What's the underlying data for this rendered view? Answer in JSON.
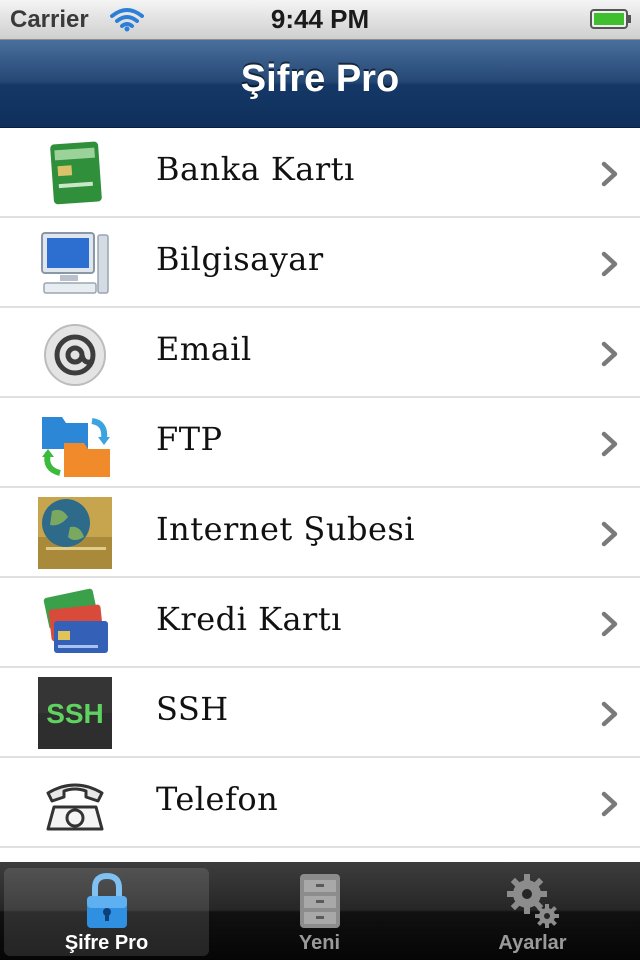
{
  "status_bar": {
    "carrier": "Carrier",
    "time": "9:44 PM",
    "wifi_icon": "wifi-icon",
    "battery_icon": "battery-icon"
  },
  "nav": {
    "title": "Şifre Pro"
  },
  "list": {
    "items": [
      {
        "label": "Banka Kartı",
        "icon": "bank-card-icon"
      },
      {
        "label": "Bilgisayar",
        "icon": "computer-icon"
      },
      {
        "label": "Email",
        "icon": "email-at-icon"
      },
      {
        "label": "FTP",
        "icon": "ftp-folder-icon"
      },
      {
        "label": "Internet Şubesi",
        "icon": "internet-globe-icon"
      },
      {
        "label": "Kredi Kartı",
        "icon": "credit-cards-icon"
      },
      {
        "label": "SSH",
        "icon": "ssh-terminal-icon",
        "icon_text": "SSH"
      },
      {
        "label": "Telefon",
        "icon": "telephone-icon"
      }
    ]
  },
  "tab_bar": {
    "tabs": [
      {
        "label": "Şifre Pro",
        "icon": "lock-icon",
        "selected": true
      },
      {
        "label": "Yeni",
        "icon": "cabinet-icon",
        "selected": false
      },
      {
        "label": "Ayarlar",
        "icon": "gear-icon",
        "selected": false
      }
    ]
  },
  "colors": {
    "nav_top": "#4a6f9c",
    "nav_bottom": "#0f2f5c",
    "tab_bar": "#111111",
    "accent_blue": "#2f8fe0",
    "ssh_green": "#5fd35f"
  }
}
